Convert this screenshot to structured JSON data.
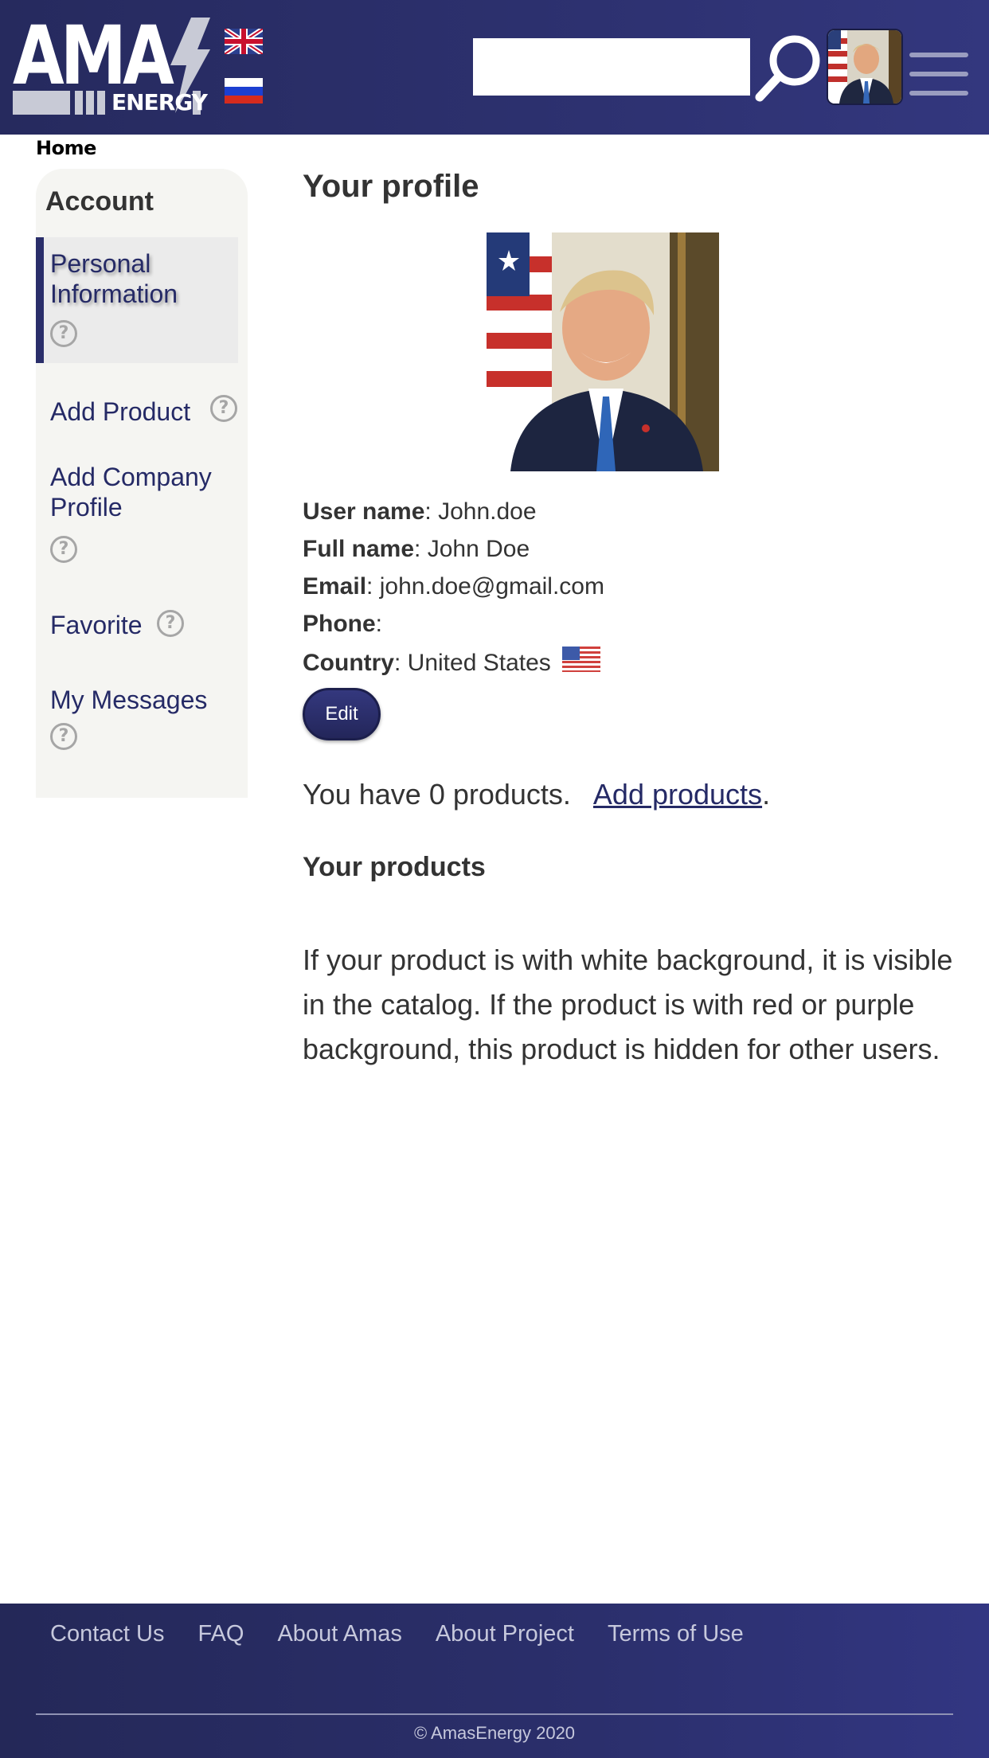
{
  "header": {
    "logo_text": "AMA",
    "logo_subtext": "ENERGY",
    "search": {
      "value": "",
      "placeholder": ""
    },
    "languages": [
      "en",
      "ru"
    ]
  },
  "breadcrumb": {
    "home": "Home"
  },
  "sidebar": {
    "title": "Account",
    "items": [
      {
        "label": "Personal Information",
        "active": true
      },
      {
        "label": "Add Product"
      },
      {
        "label": "Add Company Profile"
      },
      {
        "label": "Favorite"
      },
      {
        "label": "My Messages"
      }
    ],
    "help_glyph": "?"
  },
  "profile": {
    "title": "Your profile",
    "fields": [
      {
        "label": "User name",
        "value": "John.doe"
      },
      {
        "label": "Full name",
        "value": "John Doe"
      },
      {
        "label": "Email",
        "value": "john.doe@gmail.com"
      },
      {
        "label": "Phone",
        "value": ""
      },
      {
        "label": "Country",
        "value": "United States"
      }
    ],
    "edit_label": "Edit"
  },
  "products": {
    "count_text": "You have 0 products.",
    "add_link": "Add products",
    "title": "Your products",
    "note": "If your product is with white background, it is visible in the catalog. If the product is with red or purple background, this product is hidden for other users."
  },
  "footer": {
    "links": [
      "Contact Us",
      "FAQ",
      "About Amas",
      "About Project",
      "Terms of Use"
    ],
    "copyright": "© AmasEnergy 2020"
  },
  "colors": {
    "header_bg": "#2a2e6a",
    "link": "#252a66",
    "sidebar_bg": "#f5f5f2",
    "active_marker": "#2a2e6a"
  }
}
